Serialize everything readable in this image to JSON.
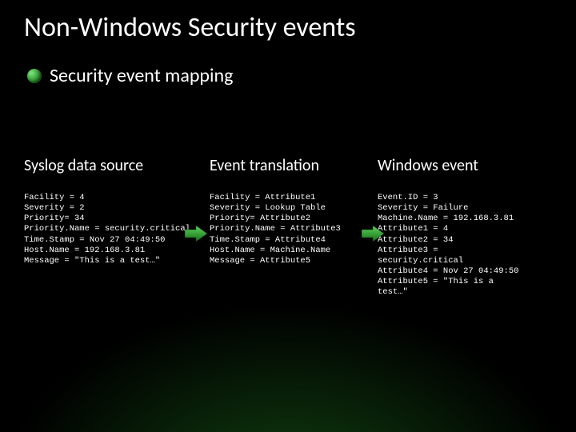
{
  "title": "Non-Windows Security events",
  "subtitle": "Security event mapping",
  "columns": {
    "syslog": {
      "heading": "Syslog data source",
      "lines": [
        "Facility = 4",
        "Severity = 2",
        "Priority= 34",
        "Priority.Name = security.critical",
        "Time.Stamp = Nov 27 04:49:50",
        "Host.Name = 192.168.3.81",
        "Message = \"This is a test…\""
      ]
    },
    "translation": {
      "heading": "Event translation",
      "lines": [
        "Facility = Attribute1",
        "Severity = Lookup Table",
        "Priority= Attribute2",
        "Priority.Name = Attribute3",
        "Time.Stamp = Attribute4",
        "Host.Name = Machine.Name",
        "Message = Attribute5"
      ]
    },
    "windows": {
      "heading": "Windows event",
      "lines": [
        "Event.ID = 3",
        "Severity = Failure",
        "Machine.Name = 192.168.3.81",
        "Attribute1 = 4",
        "Attribute2 = 34",
        "Attribute3 =",
        "security.critical",
        "Attribute4 = Nov 27 04:49:50",
        "Attribute5 = \"This is a",
        "test…\""
      ]
    }
  },
  "arrow_color": "#2e9b2e"
}
